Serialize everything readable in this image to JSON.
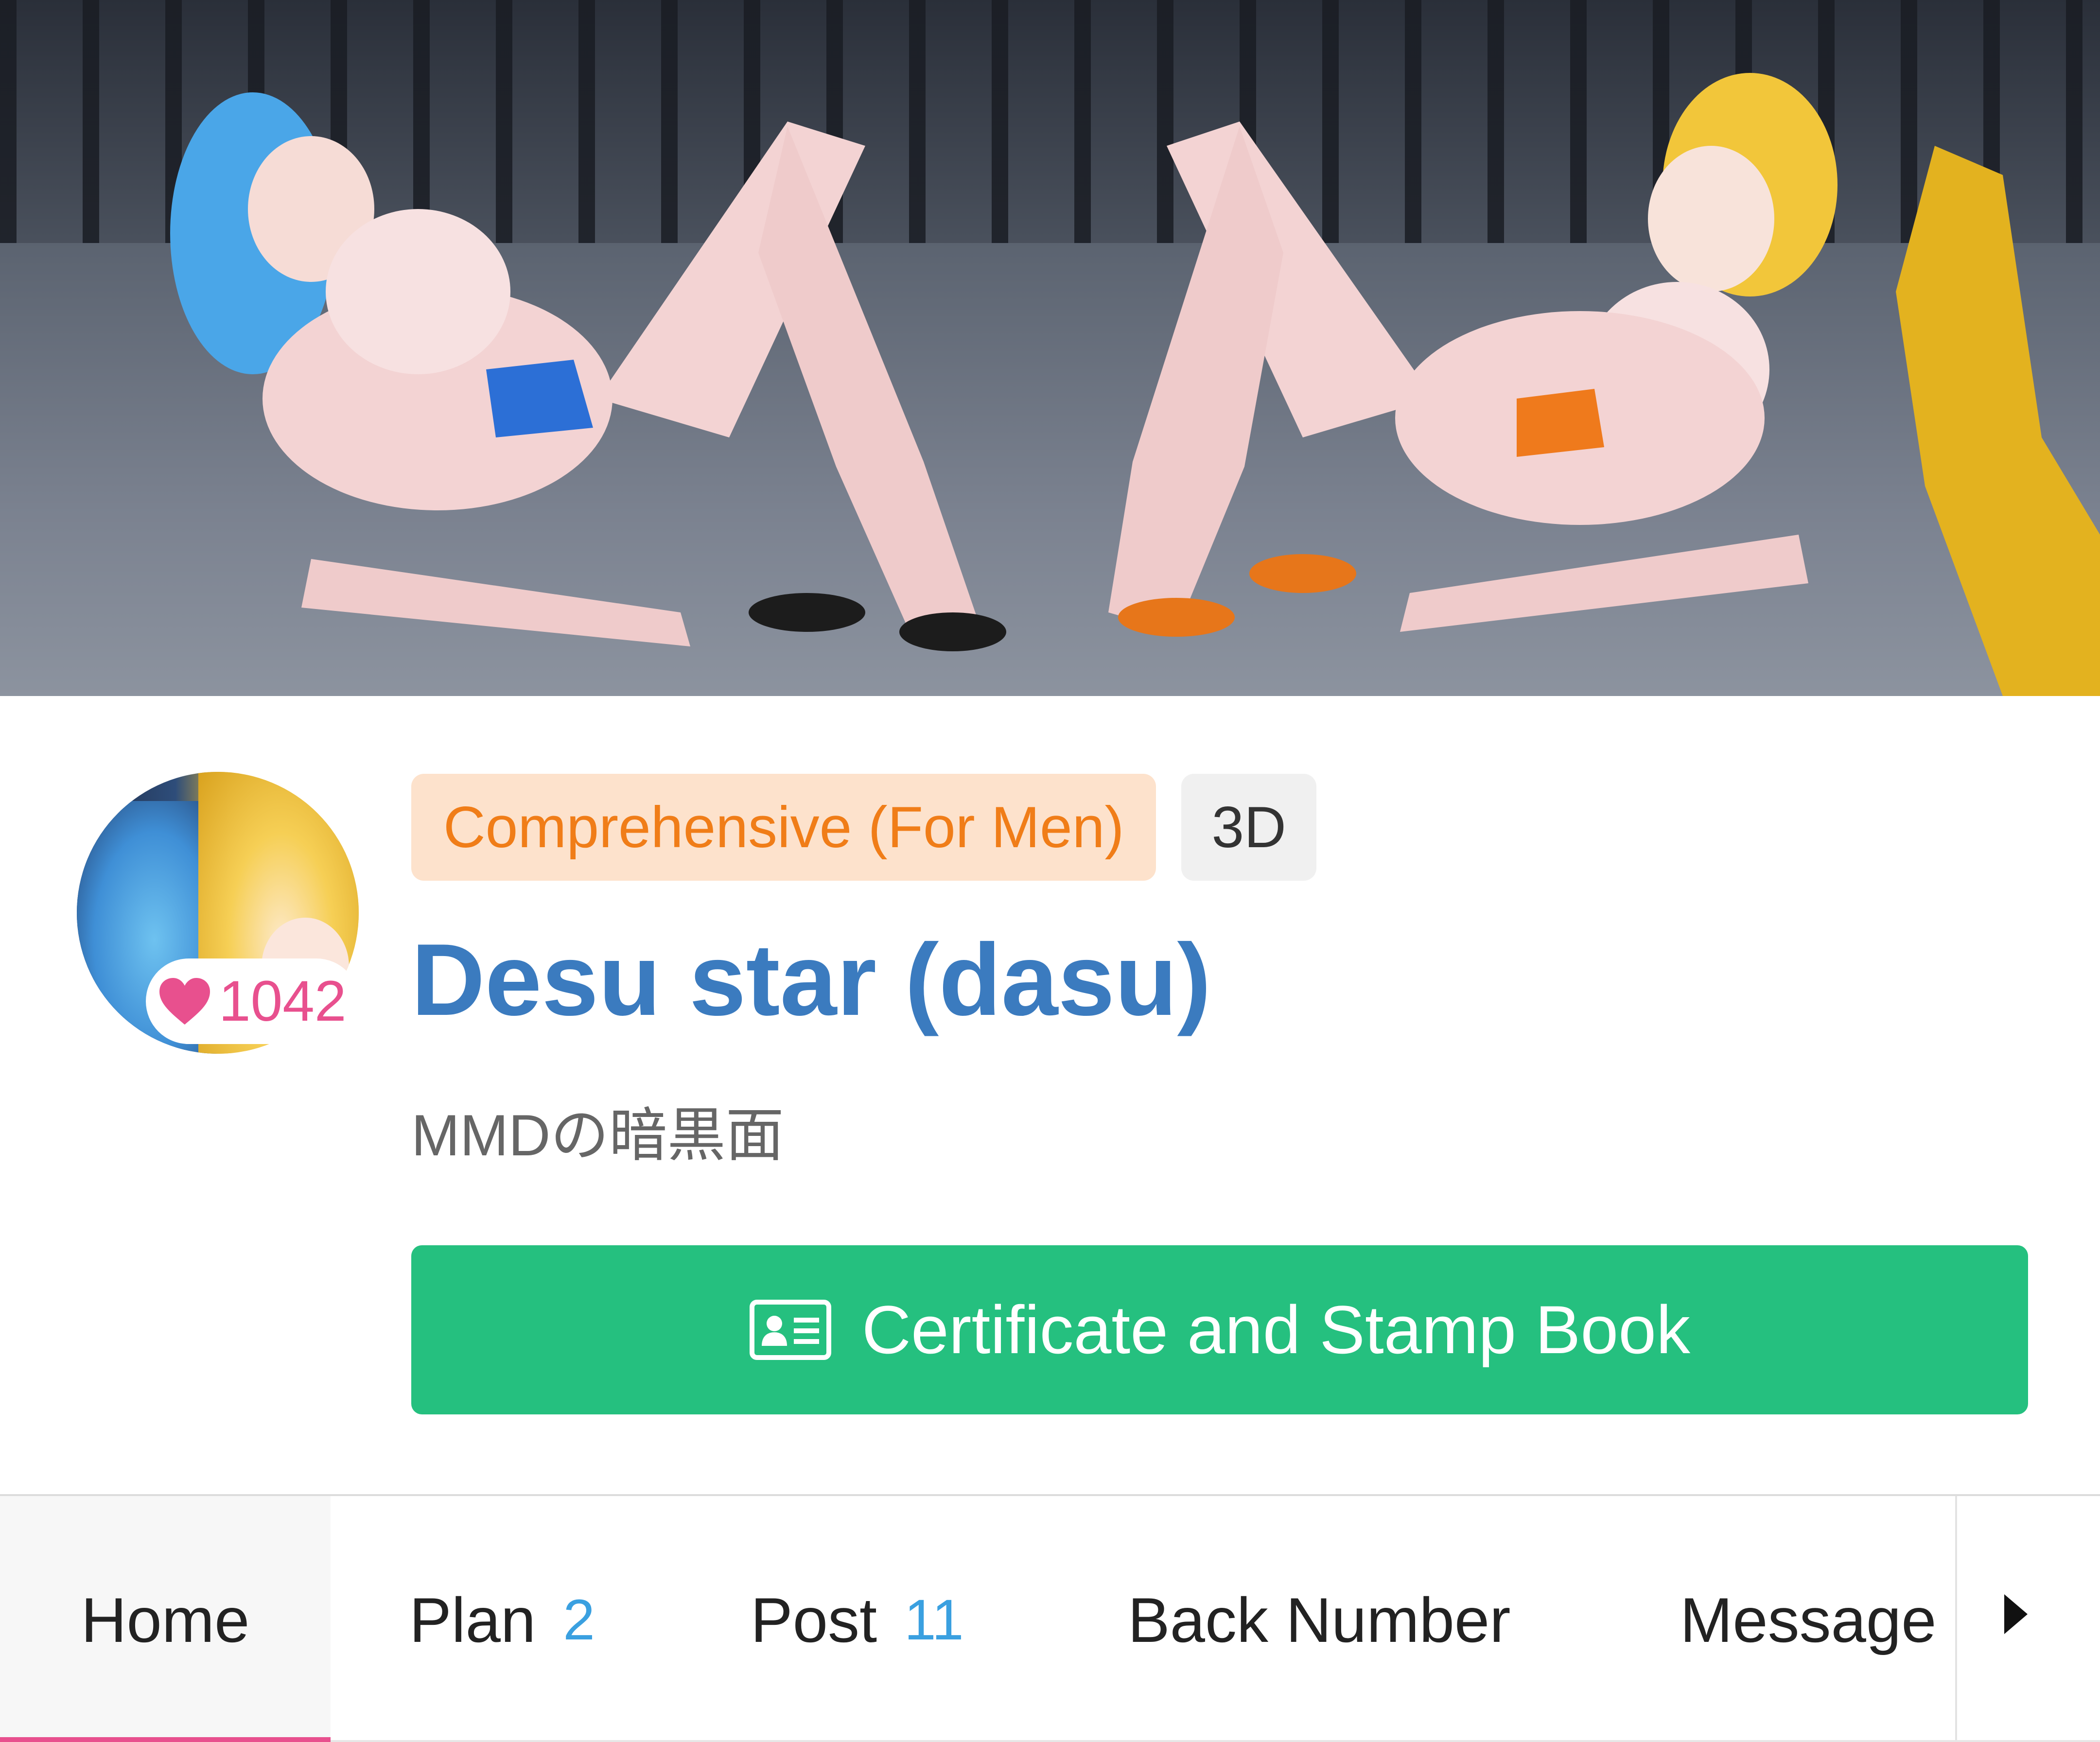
{
  "profile": {
    "likes_count": "1042",
    "tags": {
      "category": "Comprehensive (For Men)",
      "genre": "3D"
    },
    "creator_name": "Desu star (dasu)",
    "description": "MMDの暗黒面",
    "cert_button_label": "Certificate and Stamp Book"
  },
  "tabs": [
    {
      "label": "Home",
      "badge": ""
    },
    {
      "label": "Plan",
      "badge": "2"
    },
    {
      "label": "Post",
      "badge": "11"
    },
    {
      "label": "Back Number",
      "badge": ""
    },
    {
      "label": "Message",
      "badge": ""
    }
  ],
  "active_tab": "Home",
  "colors": {
    "accent_pink": "#e8508e",
    "name_blue": "#3b7bbf",
    "button_green": "#25c07f",
    "tag_orange_text": "#f07d18",
    "tag_orange_bg": "#fde2cc",
    "badge_blue": "#3aa0e0"
  },
  "icons": {
    "likes": "heart-icon",
    "cert_button": "id-card-icon",
    "tab_scroll": "caret-right-icon"
  }
}
